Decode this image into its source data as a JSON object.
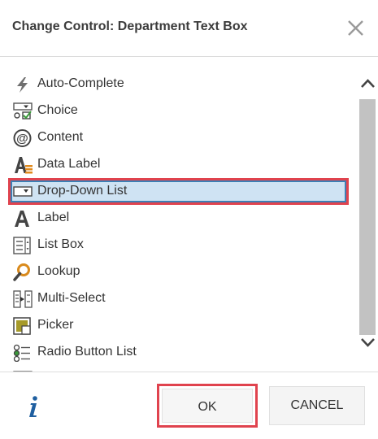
{
  "dialog": {
    "title": "Change Control: Department Text Box"
  },
  "items": [
    {
      "label": "Auto-Complete",
      "icon": "lightning-icon"
    },
    {
      "label": "Choice",
      "icon": "choice-icon"
    },
    {
      "label": "Content",
      "icon": "at-sign-icon"
    },
    {
      "label": "Data Label",
      "icon": "data-label-icon"
    },
    {
      "label": "Drop-Down List",
      "icon": "dropdown-icon",
      "selected": true
    },
    {
      "label": "Label",
      "icon": "label-icon"
    },
    {
      "label": "List Box",
      "icon": "list-box-icon"
    },
    {
      "label": "Lookup",
      "icon": "magnifier-icon"
    },
    {
      "label": "Multi-Select",
      "icon": "multi-select-icon"
    },
    {
      "label": "Picker",
      "icon": "picker-icon"
    },
    {
      "label": "Radio Button List",
      "icon": "radio-list-icon"
    }
  ],
  "footer": {
    "ok_label": "OK",
    "cancel_label": "CANCEL"
  },
  "colors": {
    "highlight_border": "#e0434e",
    "selection_fill": "#cfe3f3",
    "selection_border": "#3d7fb4",
    "info_icon": "#1f5fa0"
  }
}
